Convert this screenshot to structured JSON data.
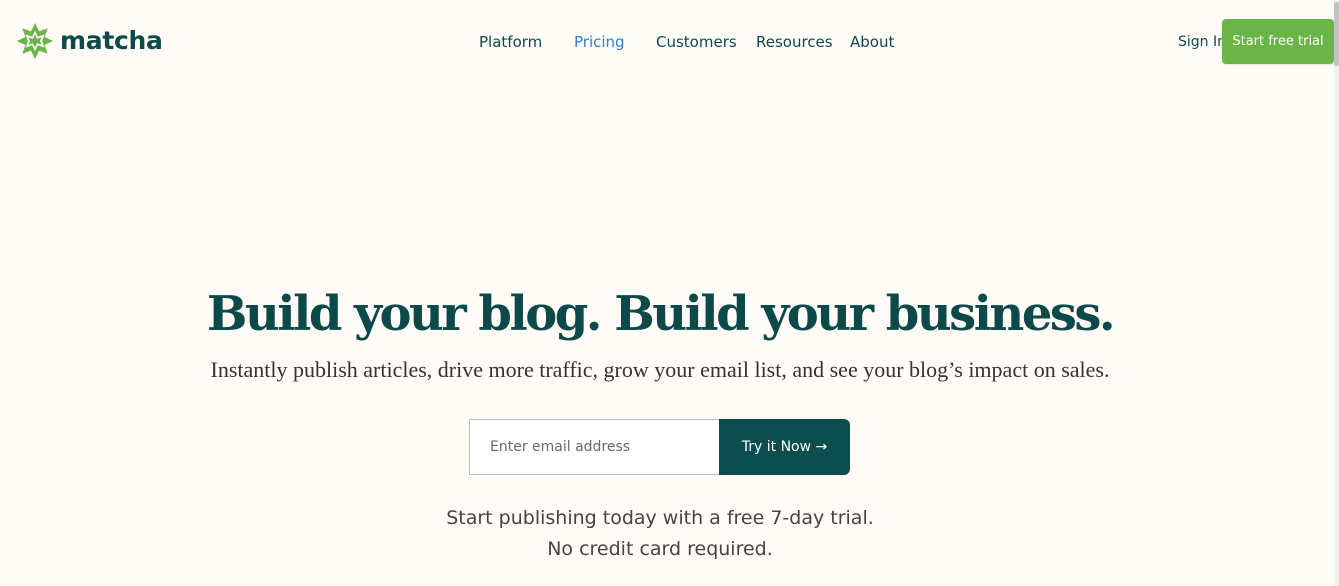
{
  "brand": {
    "name": "matcha",
    "logo_icon": "matcha-star-logo-icon",
    "colors": {
      "primary": "#0c4a4a",
      "accent_green": "#6ab448",
      "link_blue": "#2b7fd6",
      "background": "#fffcf7"
    }
  },
  "nav": {
    "items": [
      {
        "label": "Platform",
        "active": false
      },
      {
        "label": "Pricing",
        "active": true
      },
      {
        "label": "Customers",
        "active": false
      },
      {
        "label": "Resources",
        "active": false
      },
      {
        "label": "About",
        "active": false
      }
    ],
    "sign_in": "Sign In",
    "cta": "Start free trial"
  },
  "hero": {
    "title": "Build your blog. Build your business.",
    "subtitle": "Instantly publish articles, drive more traffic, grow your email list, and see your blog’s impact on sales.",
    "email_placeholder": "Enter email address",
    "button_label": "Try it Now →",
    "note_line1": "Start publishing today with a free 7-day trial.",
    "note_line2": "No credit card required."
  }
}
